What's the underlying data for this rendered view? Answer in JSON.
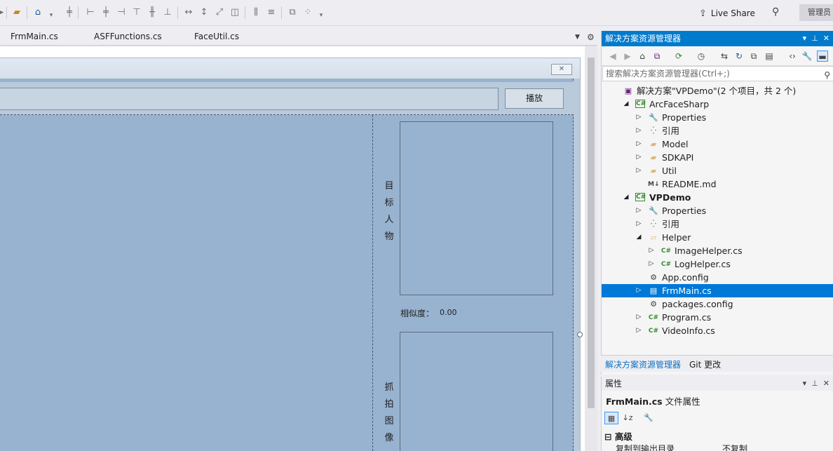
{
  "toolbar": {
    "live_share_label": "Live Share",
    "admin_label": "管理员"
  },
  "tabs": [
    {
      "label": "FrmMain.cs"
    },
    {
      "label": "ASFFunctions.cs"
    },
    {
      "label": "FaceUtil.cs"
    }
  ],
  "form": {
    "play_button": "播放",
    "url_value": "",
    "target_label": [
      "目",
      "标",
      "人",
      "物"
    ],
    "capture_label": [
      "抓",
      "拍",
      "图",
      "像"
    ],
    "similarity_label": "相似度：",
    "similarity_value": "0.00"
  },
  "solution_explorer": {
    "title": "解决方案资源管理器",
    "search_placeholder": "搜索解决方案资源管理器(Ctrl+;)",
    "tree": [
      {
        "label": "解决方案\"VPDemo\"(2 个项目，共 2 个)",
        "icon": "solution-icon",
        "indent": 0
      },
      {
        "label": "ArcFaceSharp",
        "icon": "csproj-icon",
        "indent": 1,
        "expander": "expanded"
      },
      {
        "label": "Properties",
        "icon": "wrench-icon",
        "indent": 2,
        "expander": "collapsed"
      },
      {
        "label": "引用",
        "icon": "references-icon",
        "indent": 2,
        "expander": "collapsed"
      },
      {
        "label": "Model",
        "icon": "folder-icon",
        "indent": 2,
        "expander": "collapsed"
      },
      {
        "label": "SDKAPI",
        "icon": "folder-icon",
        "indent": 2,
        "expander": "collapsed"
      },
      {
        "label": "Util",
        "icon": "folder-icon",
        "indent": 2,
        "expander": "collapsed"
      },
      {
        "label": "README.md",
        "icon": "markdown-icon",
        "indent": 2
      },
      {
        "label": "VPDemo",
        "icon": "csproj-icon",
        "indent": 1,
        "expander": "expanded",
        "bold": true
      },
      {
        "label": "Properties",
        "icon": "wrench-icon",
        "indent": 2,
        "expander": "collapsed"
      },
      {
        "label": "引用",
        "icon": "references-icon",
        "indent": 2,
        "expander": "collapsed"
      },
      {
        "label": "Helper",
        "icon": "folder-open-icon",
        "indent": 2,
        "expander": "expanded"
      },
      {
        "label": "ImageHelper.cs",
        "icon": "csharp-file-icon",
        "indent": 3,
        "expander": "collapsed"
      },
      {
        "label": "LogHelper.cs",
        "icon": "csharp-file-icon",
        "indent": 3,
        "expander": "collapsed"
      },
      {
        "label": "App.config",
        "icon": "config-icon",
        "indent": 2
      },
      {
        "label": "FrmMain.cs",
        "icon": "form-icon",
        "indent": 2,
        "expander": "collapsed",
        "selected": true
      },
      {
        "label": "packages.config",
        "icon": "config-icon",
        "indent": 2
      },
      {
        "label": "Program.cs",
        "icon": "csharp-file-icon",
        "indent": 2,
        "expander": "collapsed"
      },
      {
        "label": "VideoInfo.cs",
        "icon": "csharp-file-icon",
        "indent": 2,
        "expander": "collapsed"
      }
    ],
    "tabs": [
      {
        "label": "解决方案资源管理器"
      },
      {
        "label": "Git 更改"
      }
    ]
  },
  "properties": {
    "title": "属性",
    "object_name": "FrmMain.cs",
    "object_type": "文件属性",
    "category": "高级",
    "row_name": "复制到输出目录",
    "row_value": "不复制"
  },
  "colors": {
    "accent": "#007acc",
    "selection": "#0078d7",
    "form_client": "#98b3d0"
  }
}
